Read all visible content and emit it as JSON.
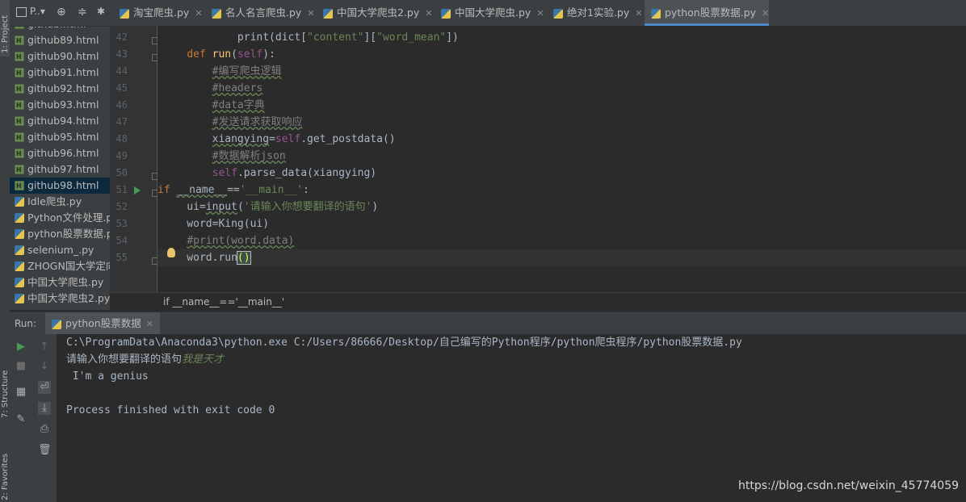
{
  "sidebar": {
    "project_tab": "1: Project",
    "structure_tab": "7: Structure",
    "favorites_tab": "2: Favorites"
  },
  "project_toolbar": {
    "title": "P..▾"
  },
  "files": [
    {
      "name": "github.html",
      "type": "html",
      "selected": false
    },
    {
      "name": "github89.html",
      "type": "html",
      "selected": false
    },
    {
      "name": "github90.html",
      "type": "html",
      "selected": false
    },
    {
      "name": "github91.html",
      "type": "html",
      "selected": false
    },
    {
      "name": "github92.html",
      "type": "html",
      "selected": false
    },
    {
      "name": "github93.html",
      "type": "html",
      "selected": false
    },
    {
      "name": "github94.html",
      "type": "html",
      "selected": false
    },
    {
      "name": "github95.html",
      "type": "html",
      "selected": false
    },
    {
      "name": "github96.html",
      "type": "html",
      "selected": false
    },
    {
      "name": "github97.html",
      "type": "html",
      "selected": false
    },
    {
      "name": "github98.html",
      "type": "html",
      "selected": true
    },
    {
      "name": "Idle爬虫.py",
      "type": "py",
      "selected": false
    },
    {
      "name": "Python文件处理.py",
      "type": "py",
      "selected": false
    },
    {
      "name": "python股票数据.py",
      "type": "py",
      "selected": false
    },
    {
      "name": "selenium_.py",
      "type": "py",
      "selected": false
    },
    {
      "name": "ZHOGN国大学定向",
      "type": "py",
      "selected": false
    },
    {
      "name": "中国大学爬虫.py",
      "type": "py",
      "selected": false
    },
    {
      "name": "中国大学爬虫2.py",
      "type": "py",
      "selected": false
    }
  ],
  "tabs": [
    {
      "label": "淘宝爬虫.py",
      "active": false
    },
    {
      "label": "名人名言爬虫.py",
      "active": false
    },
    {
      "label": "中国大学爬虫2.py",
      "active": false
    },
    {
      "label": "中国大学爬虫.py",
      "active": false
    },
    {
      "label": "绝对1实验.py",
      "active": false
    },
    {
      "label": "python股票数据.py",
      "active": true
    }
  ],
  "editor": {
    "line_numbers": [
      "42",
      "43",
      "44",
      "45",
      "46",
      "47",
      "48",
      "49",
      "50",
      "51",
      "52",
      "53",
      "54",
      "55"
    ],
    "breadcrumb": "if __name__=='__main__'"
  },
  "run": {
    "label": "Run:",
    "tab": "python股票数据",
    "console": {
      "command": "C:\\ProgramData\\Anaconda3\\python.exe C:/Users/86666/Desktop/自己编写的Python程序/python爬虫程序/python股票数据.py",
      "prompt": "请输入你想要翻译的语句",
      "user_input": "我是天才",
      "output": " I'm a genius",
      "finish": "Process finished with exit code 0"
    }
  },
  "watermark": "https://blog.csdn.net/weixin_45774059"
}
